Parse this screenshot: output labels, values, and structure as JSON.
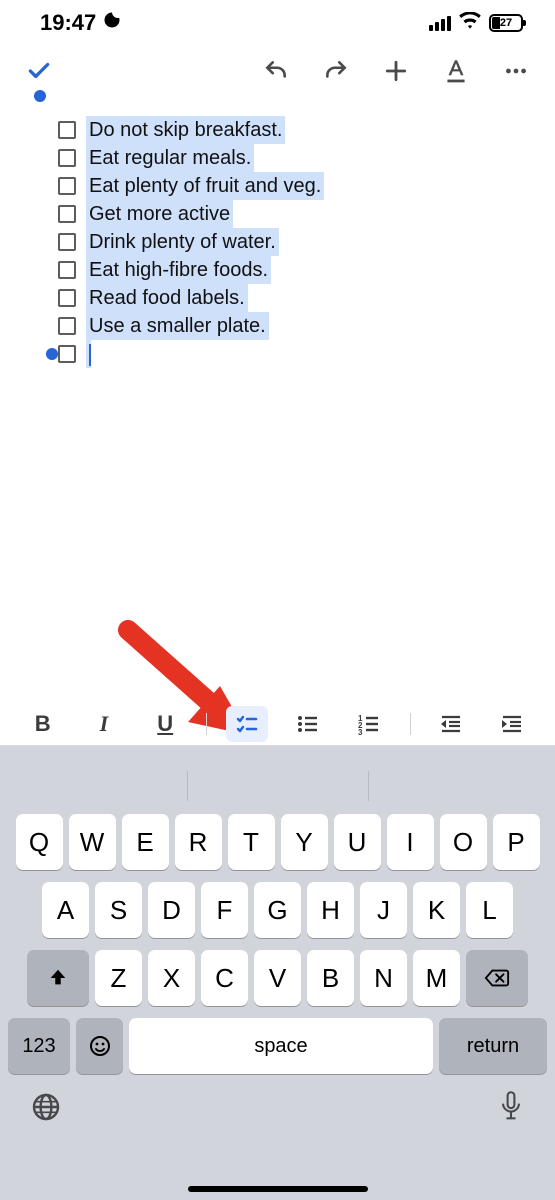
{
  "status": {
    "time": "19:47",
    "battery": "27"
  },
  "checklist": {
    "items": [
      "Do not skip breakfast.",
      "Eat regular meals.",
      "Eat plenty of fruit and veg.",
      "Get more active",
      "Drink plenty of water.",
      "Eat high-fibre foods.",
      "Read food labels.",
      "Use a smaller plate."
    ]
  },
  "format_bar": {
    "bold": "B",
    "italic": "I",
    "underline": "U"
  },
  "keyboard": {
    "row1": [
      "Q",
      "W",
      "E",
      "R",
      "T",
      "Y",
      "U",
      "I",
      "O",
      "P"
    ],
    "row2": [
      "A",
      "S",
      "D",
      "F",
      "G",
      "H",
      "J",
      "K",
      "L"
    ],
    "row3": [
      "Z",
      "X",
      "C",
      "V",
      "B",
      "N",
      "M"
    ],
    "numbers": "123",
    "space": "space",
    "enter": "return"
  }
}
